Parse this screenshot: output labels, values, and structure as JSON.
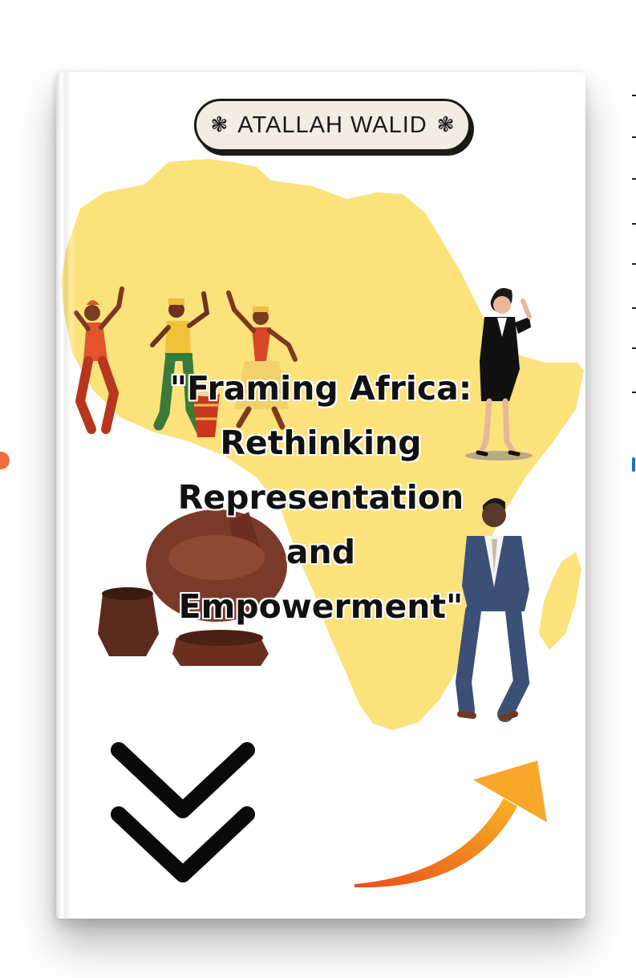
{
  "book": {
    "author": "ATALLAH WALID",
    "author_ornament_left": "❃",
    "author_ornament_right": "❃",
    "title_lines": [
      "\"Framing Africa:",
      "Rethinking",
      "Representation",
      "and",
      "Empowerment\""
    ]
  },
  "colors": {
    "map_yellow": "#fbe27a",
    "accent_orange": "#f59a1a",
    "pill_bg": "#f1ede3",
    "ink": "#111111"
  },
  "icons": {
    "map": "africa-map-icon",
    "dancers": "dancers-illustration",
    "pots": "clay-pots-illustration",
    "woman": "businesswoman-illustration",
    "man": "businessman-illustration",
    "chevrons": "double-chevron-down-icon",
    "arrow": "curved-arrow-up-icon"
  }
}
